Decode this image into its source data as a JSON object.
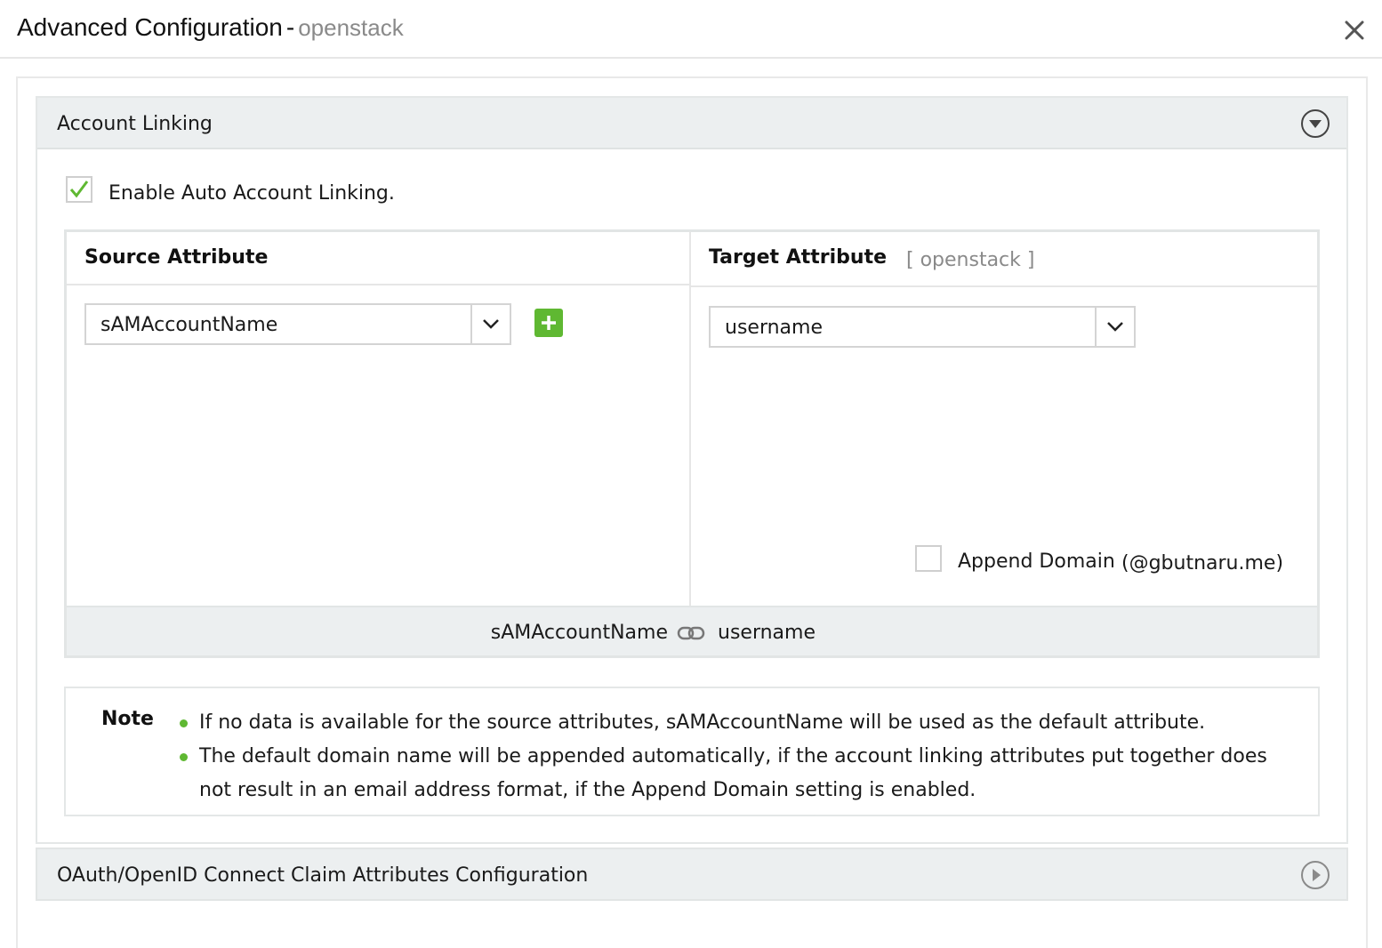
{
  "dialog": {
    "title": "Advanced Configuration",
    "separator": "-",
    "subtitle": "openstack",
    "close_icon": "close-icon"
  },
  "account_linking": {
    "title": "Account Linking",
    "toggle_icon": "chevron-down-circle-icon",
    "expanded": true,
    "enable_auto_linking": {
      "label": "Enable Auto Account Linking.",
      "checked": true
    },
    "source": {
      "header": "Source Attribute",
      "selected": "sAMAccountName",
      "add_icon": "plus-icon"
    },
    "target": {
      "header": "Target Attribute",
      "app_tag": "[ openstack ]",
      "selected": "username",
      "append_domain": {
        "label": "Append Domain",
        "domain": "(@gbutnaru.me)",
        "checked": false
      }
    },
    "mapping": {
      "source": "sAMAccountName",
      "link_icon": "link-icon",
      "target": "username"
    },
    "note": {
      "label": "Note",
      "items": [
        "If no data is available for the source attributes, sAMAccountName will be used as the default attribute.",
        "The default domain name will be appended automatically, if the account linking attributes put together does not result in an email address format, if the Append Domain setting is enabled."
      ]
    }
  },
  "oauth": {
    "title": "OAuth/OpenID Connect Claim Attributes Configuration",
    "toggle_icon": "chevron-right-circle-icon",
    "expanded": false
  },
  "colors": {
    "accent_green": "#5fb832",
    "header_gray": "#eceff0",
    "muted_text": "#8a8a8a"
  }
}
